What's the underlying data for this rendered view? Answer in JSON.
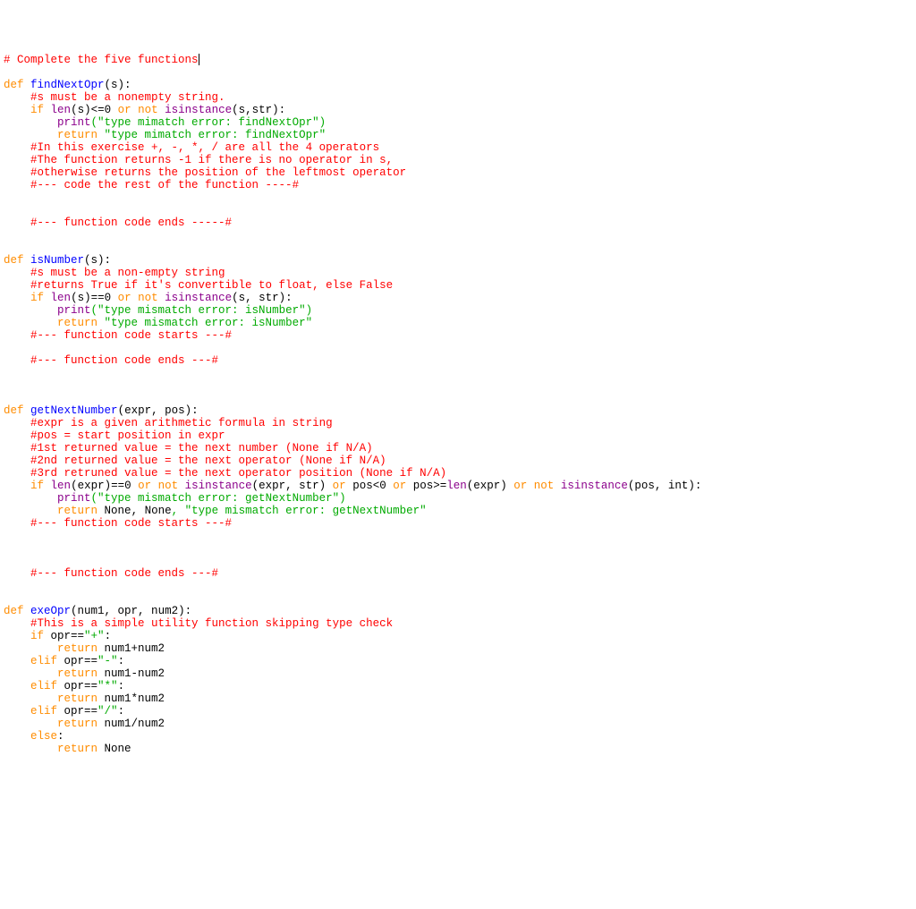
{
  "code": {
    "l1_comment": "# Complete the five functions",
    "def": "def",
    "if": "if",
    "or": "or",
    "not": "not",
    "return": "return",
    "elif": "elif",
    "else": "else",
    "len": "len",
    "isinstance": "isinstance",
    "print": "print",
    "None": "None",
    "fn1": {
      "name": "findNextOpr",
      "sig_tail": "(s):",
      "c1": "#s must be a nonempty string.",
      "cond": " len(s)<=0 ",
      "cond2": " isinstance(s,str):",
      "p_arg": "(\"type mimatch error: findNextOpr\")",
      "ret_str": " \"type mimatch error: findNextOpr\"",
      "c2": "#In this exercise +, -, *, / are all the 4 operators",
      "c3": "#The function returns -1 if there is no operator in s,",
      "c4": "#otherwise returns the position of the leftmost operator",
      "c5": "#--- code the rest of the function ----#",
      "c6": "#--- function code ends -----#"
    },
    "fn2": {
      "name": "isNumber",
      "sig_tail": "(s):",
      "c1": "#s must be a non-empty string",
      "c2": "#returns True if it's convertible to float, else False",
      "cond": " len(s)==0 ",
      "cond2": " isinstance(s, str):",
      "p_arg": "(\"type mismatch error: isNumber\")",
      "ret_str": " \"type mismatch error: isNumber\"",
      "c3": "#--- function code starts ---#",
      "c4": "#--- function code ends ---#"
    },
    "fn3": {
      "name": "getNextNumber",
      "sig_tail": "(expr, pos):",
      "c1": "#expr is a given arithmetic formula in string",
      "c2": "#pos = start position in expr",
      "c3": "#1st returned value = the next number (None if N/A)",
      "c4": "#2nd returned value = the next operator (None if N/A)",
      "c5": "#3rd retruned value = the next operator position (None if N/A)",
      "cond_a": " len(expr)==0 ",
      "cond_b": " isinstance(expr, str) ",
      "cond_c": " pos<0 ",
      "cond_d": " pos>=len(expr) ",
      "cond_e": " isinstance(pos, int):",
      "p_arg": "(\"type mismatch error: getNextNumber\")",
      "ret_tail": ", \"type mismatch error: getNextNumber\"",
      "c6": "#--- function code starts ---#",
      "c7": "#--- function code ends ---#"
    },
    "fn4": {
      "name": "exeOpr",
      "sig_tail": "(num1, opr, num2):",
      "c1": "#This is a simple utility function skipping type check",
      "if1": " opr==\"+\":",
      "r1": " num1+num2",
      "if2": " opr==\"-\":",
      "r2": " num1-num2",
      "if3": " opr==\"*\":",
      "r3": " num1*num2",
      "if4": " opr==\"/\":",
      "r4": " num1/num2",
      "else_t": ":"
    }
  }
}
